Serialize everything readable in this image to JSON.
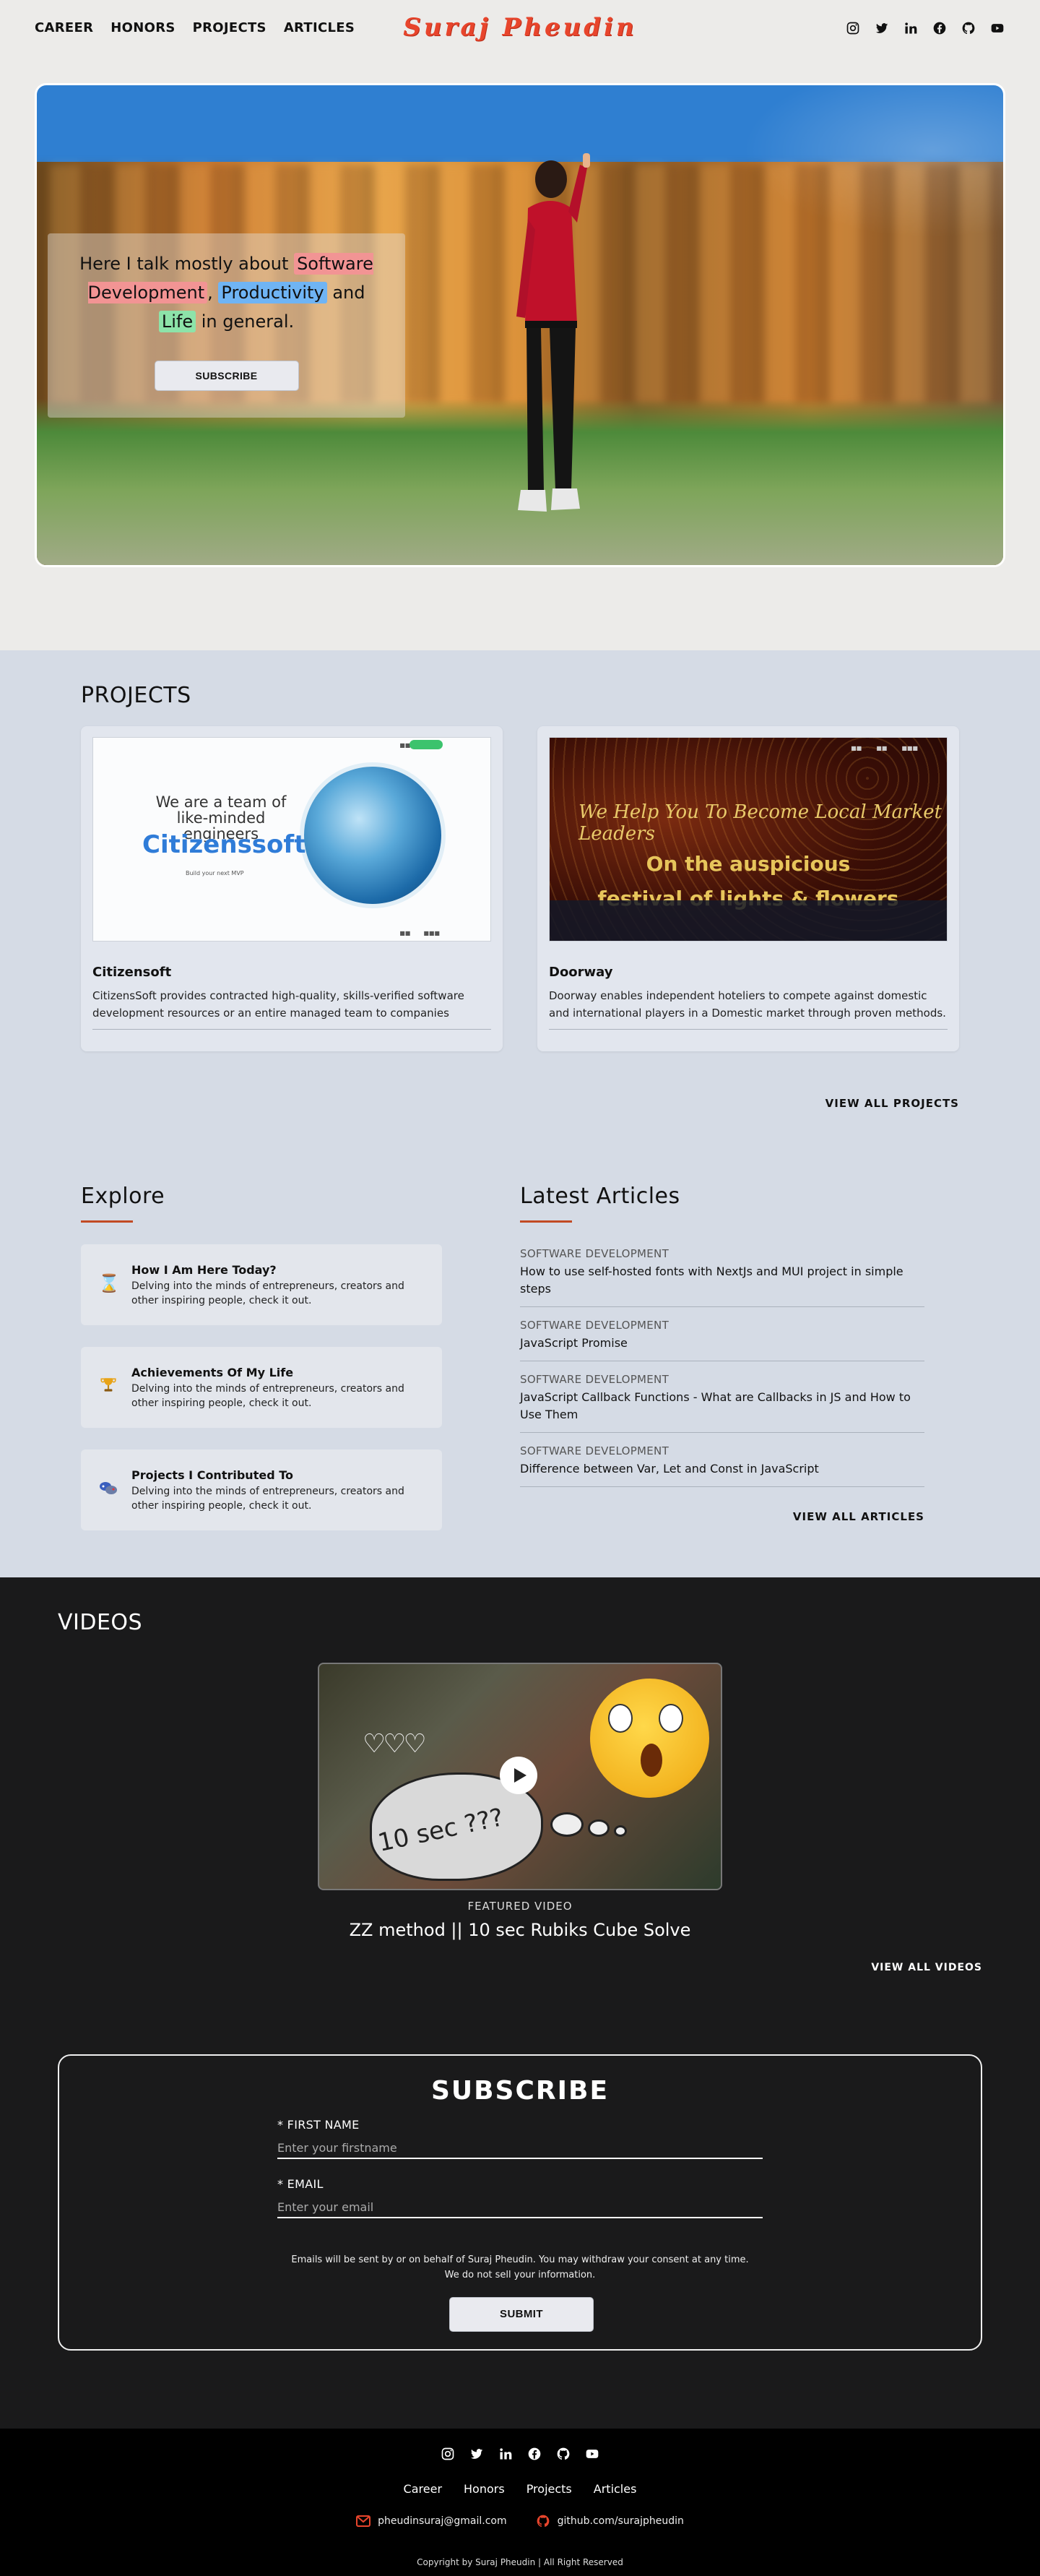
{
  "nav": {
    "links": [
      "CAREER",
      "HONORS",
      "PROJECTS",
      "ARTICLES"
    ],
    "logo": "Suraj Pheudin"
  },
  "social_icons": [
    "instagram-icon",
    "twitter-icon",
    "linkedin-icon",
    "facebook-icon",
    "github-icon",
    "youtube-icon"
  ],
  "hero": {
    "text_1": "Here I talk mostly about",
    "highlight_1": "Software Development",
    "sep_1": ",",
    "highlight_2": "Productivity",
    "text_2": "and",
    "highlight_3": "Life",
    "text_3": "in general.",
    "subscribe_label": "SUBSCRIBE"
  },
  "projects": {
    "title": "PROJECTS",
    "items": [
      {
        "name": "Citizensoft",
        "description": "CitizensSoft provides contracted high-quality, skills-verified software development resources or an entire managed team to companies aroun...",
        "image_text_1": "We are a team of like-minded engineers",
        "image_text_2": "Citizenssoft",
        "image_text_3": "Build your next MVP"
      },
      {
        "name": "Doorway",
        "description": "Doorway enables independent hoteliers to compete against domestic and international players in a Domestic market through proven methods.",
        "image_text_1": "We Help You To Become Local Market Leaders",
        "image_text_2": "On the auspicious",
        "image_text_3": "festival of lights & flowers"
      }
    ],
    "view_all": "VIEW ALL PROJECTS"
  },
  "explore": {
    "title": "Explore",
    "items": [
      {
        "title": "How I Am Here Today?",
        "description": "Delving into the minds of entrepreneurs, creators and other inspiring people, check it out.",
        "icon": "hourglass-icon"
      },
      {
        "title": "Achievements Of My Life",
        "description": "Delving into the minds of entrepreneurs, creators and other inspiring people, check it out.",
        "icon": "trophy-icon"
      },
      {
        "title": "Projects I Contributed To",
        "description": "Delving into the minds of entrepreneurs, creators and other inspiring people, check it out.",
        "icon": "gamepad-icon"
      }
    ]
  },
  "articles": {
    "title": "Latest Articles",
    "items": [
      {
        "category": "SOFTWARE DEVELOPMENT",
        "title": "How to use self-hosted fonts with NextJs and MUI project in simple steps"
      },
      {
        "category": "SOFTWARE DEVELOPMENT",
        "title": "JavaScript Promise"
      },
      {
        "category": "SOFTWARE DEVELOPMENT",
        "title": "JavaScript Callback Functions - What are Callbacks in JS and How to Use Them"
      },
      {
        "category": "SOFTWARE DEVELOPMENT",
        "title": "Difference between Var, Let and Const in JavaScript"
      }
    ],
    "view_all": "VIEW ALL ARTICLES"
  },
  "videos": {
    "title": "VIDEOS",
    "thumb_text": "10 sec ???",
    "featured_label": "FEATURED VIDEO",
    "featured_title": "ZZ method || 10 sec Rubiks Cube Solve",
    "view_all": "VIEW ALL VIDEOS"
  },
  "subscribe": {
    "title": "SUBSCRIBE",
    "first_name_label": "* FIRST NAME",
    "first_name_placeholder": "Enter your firstname",
    "email_label": "* EMAIL",
    "email_placeholder": "Enter your email",
    "note_1": "Emails will be sent by or on behalf of Suraj Pheudin. You may withdraw your consent at any time.",
    "note_2": "We do not sell your information.",
    "submit_label": "SUBMIT"
  },
  "footer": {
    "links": [
      "Career",
      "Honors",
      "Projects",
      "Articles"
    ],
    "email": "pheudinsuraj@gmail.com",
    "github": "github.com/surajpheudin",
    "copyright": "Copyright by Suraj Pheudin | All Right Reserved"
  },
  "colors": {
    "accent": "#e8452c",
    "underline": "#c24a24",
    "section_bg": "#d5dbe5",
    "dark_bg": "#1a1a1b"
  }
}
